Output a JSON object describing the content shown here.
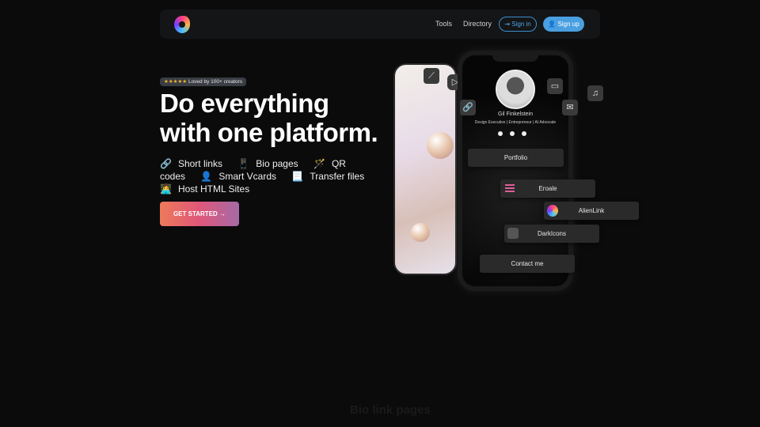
{
  "nav": {
    "tools": "Tools",
    "directory": "Directory",
    "sign_in": "Sign in",
    "sign_up": "Sign up"
  },
  "badge": {
    "stars": "★★★★★",
    "text": "Loved by 100+ creators"
  },
  "hero": {
    "line1": "Do everything",
    "line2": "with one platform.",
    "cta": "GET STARTED →"
  },
  "features": [
    {
      "emoji": "🔗",
      "label": "Short links"
    },
    {
      "emoji": "📱",
      "label": "Bio pages"
    },
    {
      "emoji": "🪄",
      "label": "QR codes"
    },
    {
      "emoji": "👤",
      "label": "Smart Vcards"
    },
    {
      "emoji": "📃",
      "label": "Transfer files"
    },
    {
      "emoji": "👩‍💻",
      "label": "Host HTML Sites"
    }
  ],
  "profile": {
    "name": "Gil Finkelstein",
    "title": "Design Executive | Entrepreneur | AI Advocate",
    "links": [
      "Portfolio",
      "Eroale",
      "AlienLink",
      "DarkIcons",
      "Contact me"
    ]
  },
  "section": {
    "title": "Bio link pages"
  }
}
